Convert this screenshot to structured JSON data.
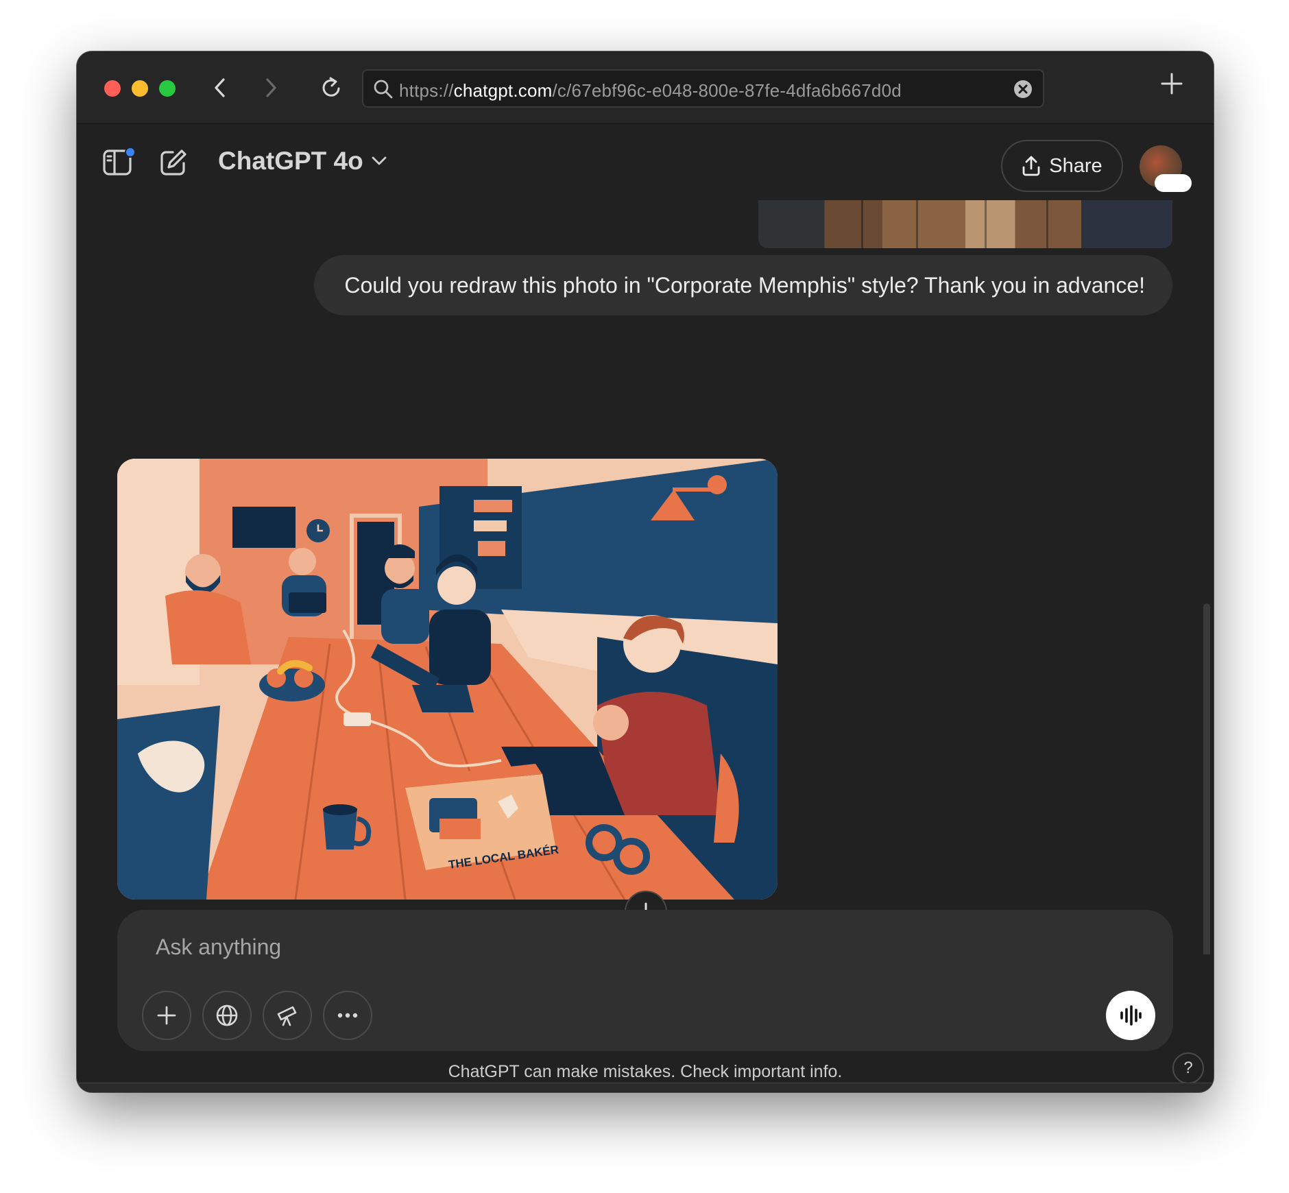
{
  "browser": {
    "url_scheme": "https://",
    "url_host": "chatgpt.com",
    "url_path": "/c/67ebf96c-e048-800e-87fe-4dfa6b667d0d"
  },
  "header": {
    "model_title": "ChatGPT 4o",
    "share_label": "Share"
  },
  "conversation": {
    "user_message": "Could you redraw this photo in \"Corporate Memphis\" style? Thank you in advance!",
    "image_crate_text": "THE LOCAL BAKÉR"
  },
  "composer": {
    "placeholder": "Ask anything"
  },
  "footer": {
    "disclaimer": "ChatGPT can make mistakes. Check important info.",
    "help_label": "?"
  },
  "colors": {
    "window_bg": "#212121",
    "bubble_bg": "#303030",
    "accent_orange": "#e8744a",
    "accent_navy": "#1f3f62"
  },
  "icons": [
    "sidebar-icon",
    "compose-icon",
    "chevron-down-icon",
    "share-icon",
    "search-icon",
    "close-icon",
    "plus-icon",
    "globe-icon",
    "telescope-icon",
    "more-icon",
    "voice-icon",
    "arrow-down-icon",
    "back-icon",
    "forward-icon",
    "reload-icon"
  ]
}
